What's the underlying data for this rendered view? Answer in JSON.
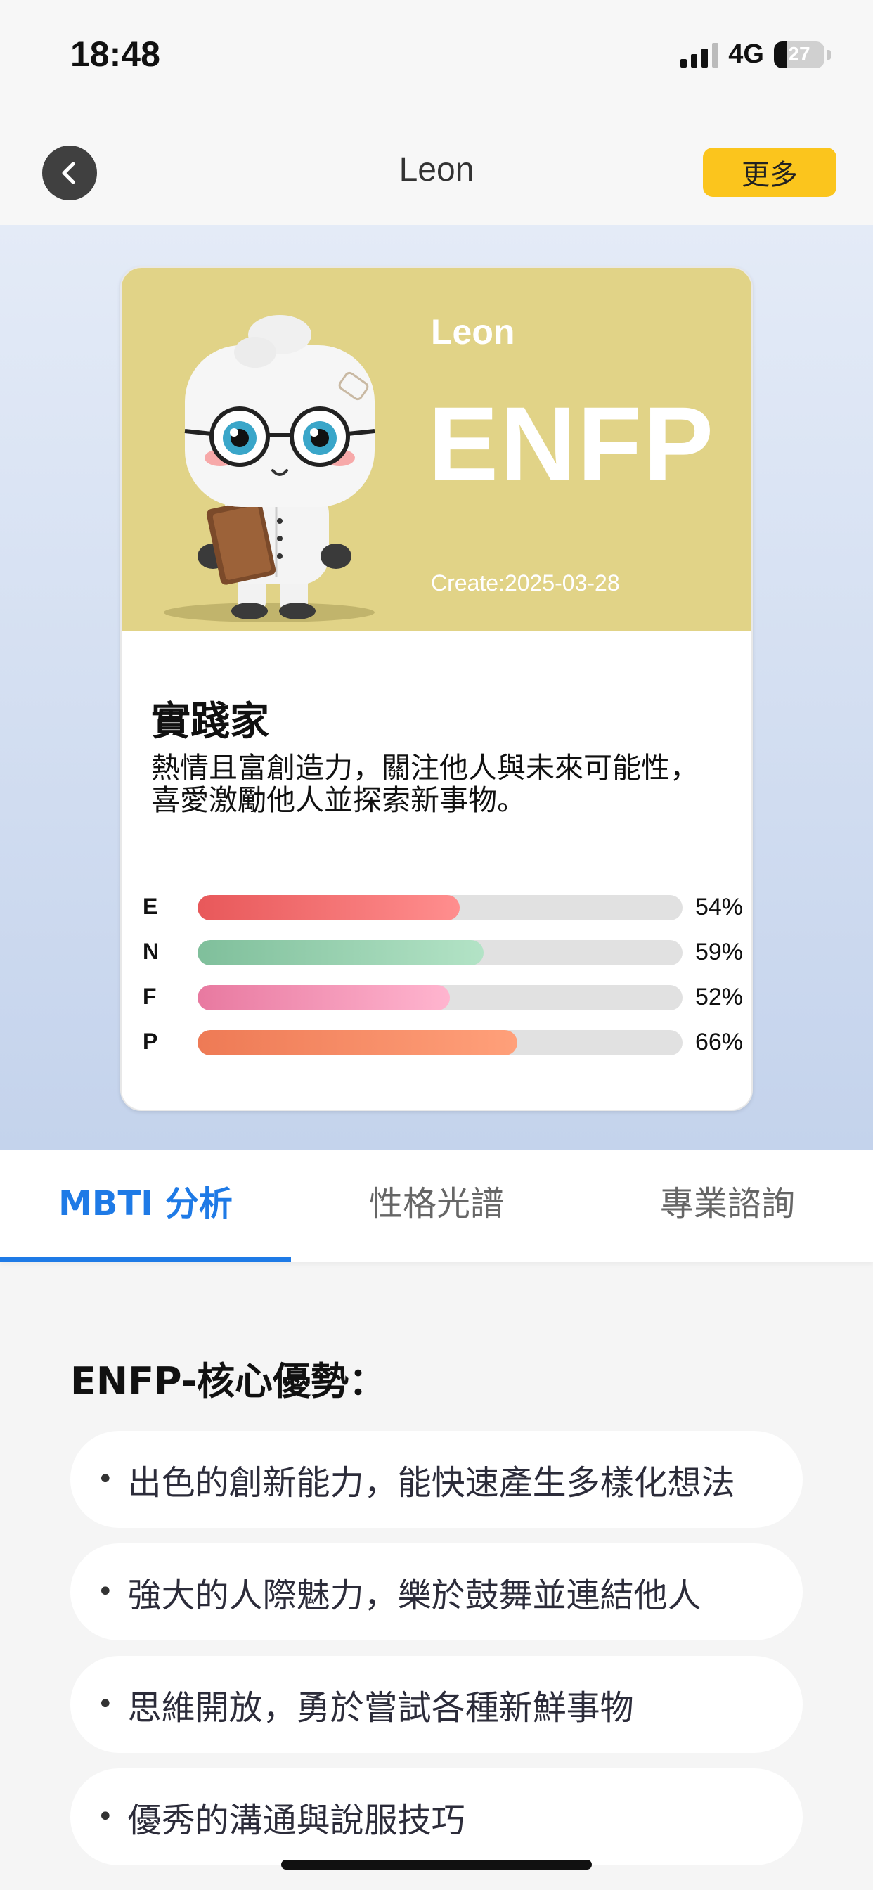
{
  "status_bar": {
    "time": "18:48",
    "network": "4G",
    "battery_level": "27",
    "battery_fraction": 0.27
  },
  "navbar": {
    "title": "Leon",
    "more_label": "更多",
    "back_icon": "chevron-left-icon"
  },
  "card": {
    "name": "Leon",
    "type": "ENFP",
    "created": "Create:2025-03-28",
    "background_color": "#e1d387",
    "title": "實踐家",
    "description": "熱情且富創造力，關注他人與未來可能性，喜愛激勵他人並探索新事物。",
    "traits": [
      {
        "letter": "E",
        "percent_label": "54%",
        "value": 54,
        "color_from": "#e8585a",
        "color_to": "#ff8e8e"
      },
      {
        "letter": "N",
        "percent_label": "59%",
        "value": 59,
        "color_from": "#7fbf9b",
        "color_to": "#b3e3c6"
      },
      {
        "letter": "F",
        "percent_label": "52%",
        "value": 52,
        "color_from": "#e879a0",
        "color_to": "#ffb5cf"
      },
      {
        "letter": "P",
        "percent_label": "66%",
        "value": 66,
        "color_from": "#ee7a55",
        "color_to": "#ffa07a"
      }
    ]
  },
  "tabs": [
    {
      "label": "MBTI 分析",
      "active": true
    },
    {
      "label": "性格光譜",
      "active": false
    },
    {
      "label": "專業諮詢",
      "active": false
    }
  ],
  "content": {
    "section_title": "ENFP-核心優勢：",
    "strengths": [
      "出色的創新能力，能快速產生多樣化想法",
      "強大的人際魅力，樂於鼓舞並連結他人",
      "思維開放，勇於嘗試各種新鮮事物",
      "優秀的溝通與說服技巧"
    ]
  },
  "colors": {
    "accent": "#1e7ae6",
    "more_button": "#fbc51d"
  }
}
